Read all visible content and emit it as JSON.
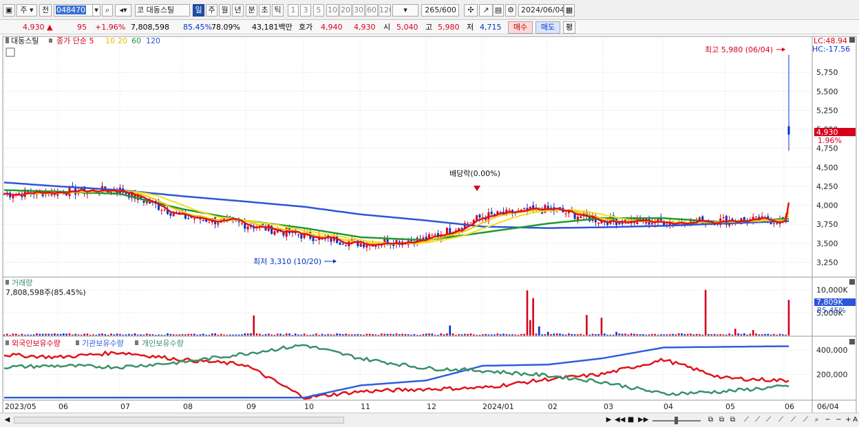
{
  "toolbar": {
    "type_select": "주",
    "period_select": "전",
    "stock_code": "048470",
    "stock_name": "대동스틸",
    "stock_prefix": "코",
    "periods": [
      "일",
      "주",
      "월",
      "년",
      "분",
      "초",
      "틱"
    ],
    "active_period": "일",
    "intervals": [
      "1",
      "3",
      "5",
      "10",
      "20",
      "30",
      "60",
      "120"
    ],
    "count": "265",
    "count_max": "/600",
    "date": "2024/06/04"
  },
  "quote": {
    "price": "4,930",
    "change": "95",
    "change_pct": "+1.96%",
    "volume": "7,808,598",
    "vol_ratio": "85.45%",
    "rate2": "78.09%",
    "amount": "43,181백만",
    "ask_label": "호가",
    "ask": "4,940",
    "bid": "4,930",
    "open_label": "시",
    "open": "5,040",
    "high_label": "고",
    "high": "5,980",
    "low_label": "저",
    "low": "4,715",
    "buy": "매수",
    "sell": "매도",
    "eval": "평"
  },
  "price_panel": {
    "legend_name": "대동스틸",
    "legend_ma": "종가 단순 5",
    "ma_10": "10",
    "ma_20": "20",
    "ma_60": "60",
    "ma_120": "120",
    "lc": "LC:48.94",
    "hc": "HC:-17.56",
    "max_label": "최고 5,980 (06/04)",
    "min_label": "최저 3,310 (10/20)",
    "dividend_label": "배당락(0.00%)",
    "current_price": "4,930",
    "current_pct": "1.96%"
  },
  "volume_panel": {
    "title": "거래량",
    "value": "7,808,598주(85.45%)",
    "current": "7,809K",
    "current_pct": "85.45%"
  },
  "holdings_panel": {
    "foreign": "외국인보유수량",
    "inst": "기관보유수량",
    "retail": "개인보유수량"
  },
  "colors": {
    "up": "#d6001c",
    "down": "#0033cc",
    "ma5": "#e0121a",
    "ma10": "#f0c800",
    "ma20": "#f0e020",
    "ma60": "#1f9a2e",
    "ma120": "#2c55d8",
    "foreign": "#e0121a",
    "inst": "#2c5fdc",
    "retail": "#3a9068"
  },
  "chart_data": [
    {
      "type": "candlestick",
      "title": "대동스틸",
      "y_ticks": [
        3250,
        3500,
        3750,
        4000,
        4250,
        4500,
        4750,
        5000,
        5250,
        5500,
        5750
      ],
      "ylim": [
        3100,
        6050
      ],
      "x_ticks": [
        "2023/05",
        "06",
        "07",
        "08",
        "09",
        "10",
        "11",
        "12",
        "2024/01",
        "02",
        "03",
        "04",
        "05",
        "06",
        "06/04"
      ],
      "last": {
        "date": "06/04",
        "open": 5040,
        "high": 5980,
        "low": 4715,
        "close": 4930
      },
      "max": {
        "date": "06/04",
        "value": 5980
      },
      "min": {
        "date": "10/20",
        "value": 3310
      },
      "series": [
        {
          "name": "5",
          "values_approx": "short-term close MA"
        },
        {
          "name": "10"
        },
        {
          "name": "20"
        },
        {
          "name": "60"
        },
        {
          "name": "120"
        }
      ],
      "x": [
        "2023/05",
        "06",
        "07",
        "08",
        "09",
        "10",
        "11",
        "12",
        "2024/01",
        "02",
        "03",
        "04",
        "05",
        "06"
      ],
      "close_monthly": [
        4150,
        4180,
        4200,
        3850,
        3750,
        3600,
        3500,
        3550,
        3850,
        3950,
        3800,
        3780,
        3800,
        4930
      ],
      "ma60_monthly": [
        4200,
        4180,
        4150,
        3950,
        3800,
        3700,
        3580,
        3540,
        3640,
        3760,
        3830,
        3830,
        3780,
        3820
      ],
      "ma120_monthly": [
        4300,
        4250,
        4200,
        4120,
        4050,
        3980,
        3880,
        3800,
        3720,
        3700,
        3710,
        3730,
        3760,
        3790
      ]
    },
    {
      "type": "bar",
      "title": "거래량",
      "y_ticks": [
        "10,000K",
        "5,000K"
      ],
      "unit": "주",
      "last_value": 7808598,
      "spikes": [
        {
          "date": "2023/09",
          "value": 4400
        },
        {
          "date": "2023/12 end",
          "value": 9900
        },
        {
          "date": "2024/01",
          "value": 8200
        },
        {
          "date": "2024/01",
          "value": 4500
        },
        {
          "date": "2024/02",
          "value": 4000
        },
        {
          "date": "2024/04",
          "value": 10000
        },
        {
          "date": "2024/06/04",
          "value": 7809
        }
      ]
    },
    {
      "type": "line",
      "title": "외국인/기관/개인 보유수량",
      "y_ticks": [
        "400,000",
        "200,000"
      ],
      "x": [
        "2023/05",
        "06",
        "07",
        "08",
        "09",
        "10",
        "11",
        "12",
        "2024/01",
        "02",
        "03",
        "04",
        "05",
        "06"
      ],
      "series": [
        {
          "name": "외국인보유수량",
          "values": [
            360000,
            340000,
            380000,
            320000,
            280000,
            10000,
            60000,
            80000,
            90000,
            160000,
            200000,
            320000,
            170000,
            150000
          ]
        },
        {
          "name": "기관보유수량",
          "values": [
            10000,
            10000,
            10000,
            10000,
            10000,
            10000,
            110000,
            150000,
            270000,
            280000,
            330000,
            420000,
            425000,
            430000
          ]
        },
        {
          "name": "개인보유수량",
          "values": [
            260000,
            270000,
            260000,
            300000,
            370000,
            440000,
            330000,
            250000,
            230000,
            190000,
            140000,
            40000,
            60000,
            100000
          ]
        }
      ]
    }
  ],
  "status": {
    "nav": [
      "◀",
      "▶",
      "◀◀",
      "■",
      "▶▶"
    ]
  }
}
